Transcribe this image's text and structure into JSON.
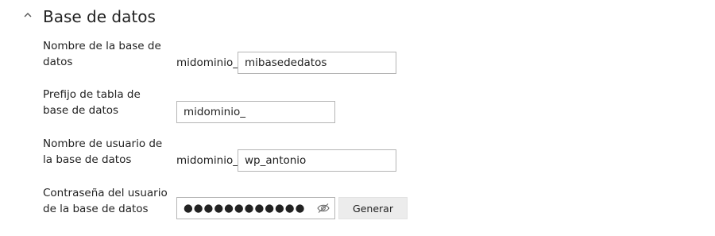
{
  "section": {
    "title": "Base de datos"
  },
  "fields": {
    "db_name": {
      "label_line1": "Nombre de la base de",
      "label_line2": "datos",
      "prefix": "midominio_",
      "value": "mibasededatos"
    },
    "table_prefix": {
      "label_line1": "Prefijo de tabla de",
      "label_line2": "base de datos",
      "value": "midominio_"
    },
    "db_user": {
      "label_line1": "Nombre de usuario de",
      "label_line2": "la base de datos",
      "prefix": "midominio_",
      "value": "wp_antonio"
    },
    "db_password": {
      "label_line1": "Contraseña del usuario",
      "label_line2": "de la base de datos",
      "value": "●●●●●●●●●●●●",
      "toggle_icon": "eye-slash-icon",
      "generate_label": "Generar"
    }
  }
}
